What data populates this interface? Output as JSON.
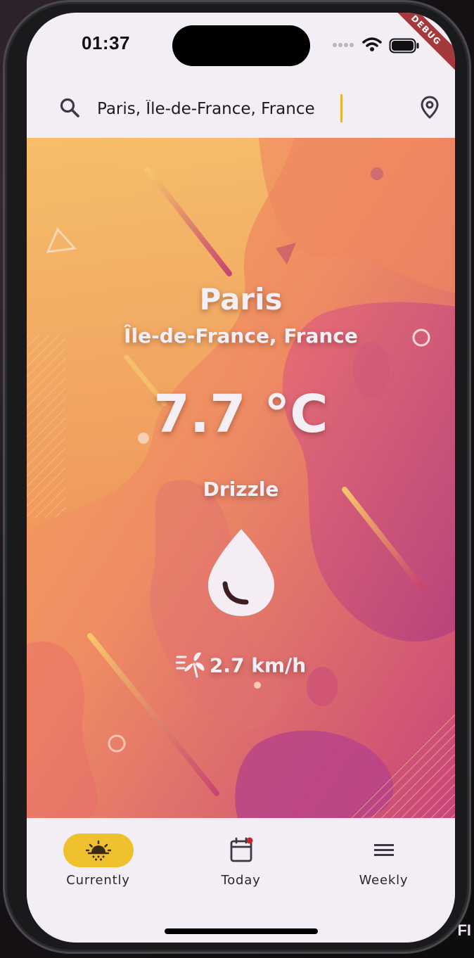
{
  "status_bar": {
    "time": "01:37",
    "debug_banner": "DEBUG"
  },
  "search": {
    "value": "Paris, Île-de-France, France",
    "icon": "search-icon",
    "location_icon": "location-pin-icon"
  },
  "weather": {
    "city": "Paris",
    "region": "Île-de-France, France",
    "temperature": "7.7 °C",
    "condition": "Drizzle",
    "condition_icon": "raindrop-icon",
    "wind_icon": "wind-fan-icon",
    "wind_speed": "2.7 km/h"
  },
  "nav": {
    "items": [
      {
        "label": "Currently",
        "icon": "sun-icon",
        "active": true
      },
      {
        "label": "Today",
        "icon": "calendar-icon",
        "active": false
      },
      {
        "label": "Weekly",
        "icon": "list-icon",
        "active": false
      }
    ]
  },
  "colors": {
    "accent": "#f0c12f",
    "surface": "#f3eef6",
    "hero_warm": "#f2b368",
    "hero_pink": "#c2477a"
  },
  "background_text": "FI"
}
